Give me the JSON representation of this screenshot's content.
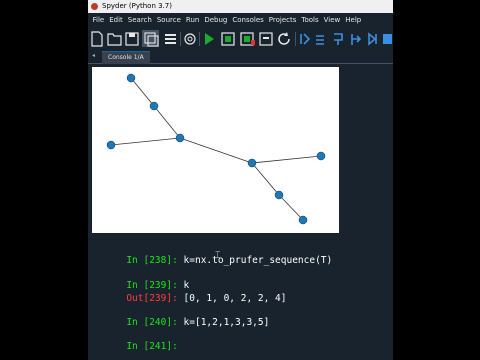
{
  "window": {
    "title": "Spyder (Python 3.7)"
  },
  "menu": [
    "File",
    "Edit",
    "Search",
    "Source",
    "Run",
    "Debug",
    "Consoles",
    "Projects",
    "Tools",
    "View",
    "Help"
  ],
  "console_tab": {
    "label": "Console 1/A"
  },
  "colors": {
    "background": "#19232d",
    "prompt": "#1be31b",
    "out_prompt": "#ff3d3d",
    "number": "#ffd23f",
    "node": "#1f77b4"
  },
  "cells": [
    {
      "prompt": "In [238]: ",
      "code": "k=nx.to_prufer_sequence(T)"
    },
    {
      "prompt": "In [239]: ",
      "code": "k"
    },
    {
      "prompt": "Out[239]: ",
      "code": "[0, 1, 0, 2, 2, 4]"
    },
    {
      "prompt": "In [240]: ",
      "code": "k=[1,2,1,3,3,5]"
    },
    {
      "prompt": "In [241]: ",
      "code": ""
    }
  ]
}
